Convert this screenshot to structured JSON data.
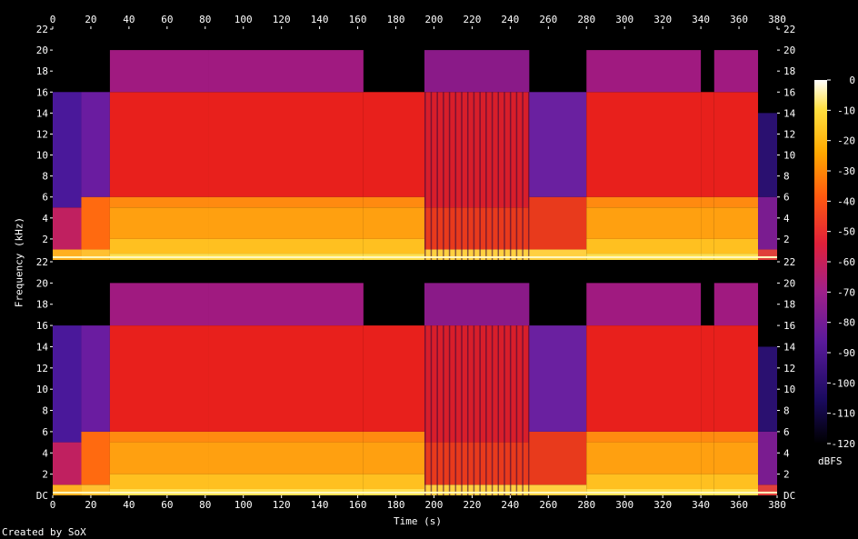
{
  "chart_data": {
    "type": "heatmap",
    "title": "",
    "xlabel": "Time (s)",
    "ylabel": "Frequency (kHz)",
    "xlim": [
      0,
      380
    ],
    "x_ticks": [
      0,
      20,
      40,
      60,
      80,
      100,
      120,
      140,
      160,
      180,
      200,
      220,
      240,
      260,
      280,
      300,
      320,
      340,
      360,
      380
    ],
    "channels": 2,
    "y_tick_labels": [
      "22",
      "20",
      "18",
      "16",
      "14",
      "12",
      "10",
      "8",
      "6",
      "4",
      "2"
    ],
    "y_bottom_label": "DC",
    "colorbar": {
      "label": "dBFS",
      "ticks": [
        "0",
        "-10",
        "-20",
        "-30",
        "-40",
        "-50",
        "-60",
        "-70",
        "-80",
        "-90",
        "-100",
        "-110",
        "-120"
      ]
    },
    "colormap": [
      "#000000",
      "#1a0a5e",
      "#5a1a9a",
      "#a0208a",
      "#e0203a",
      "#ff5a10",
      "#ffa800",
      "#ffe040",
      "#ffffff"
    ]
  },
  "footer": {
    "credit": "Created by SoX"
  }
}
